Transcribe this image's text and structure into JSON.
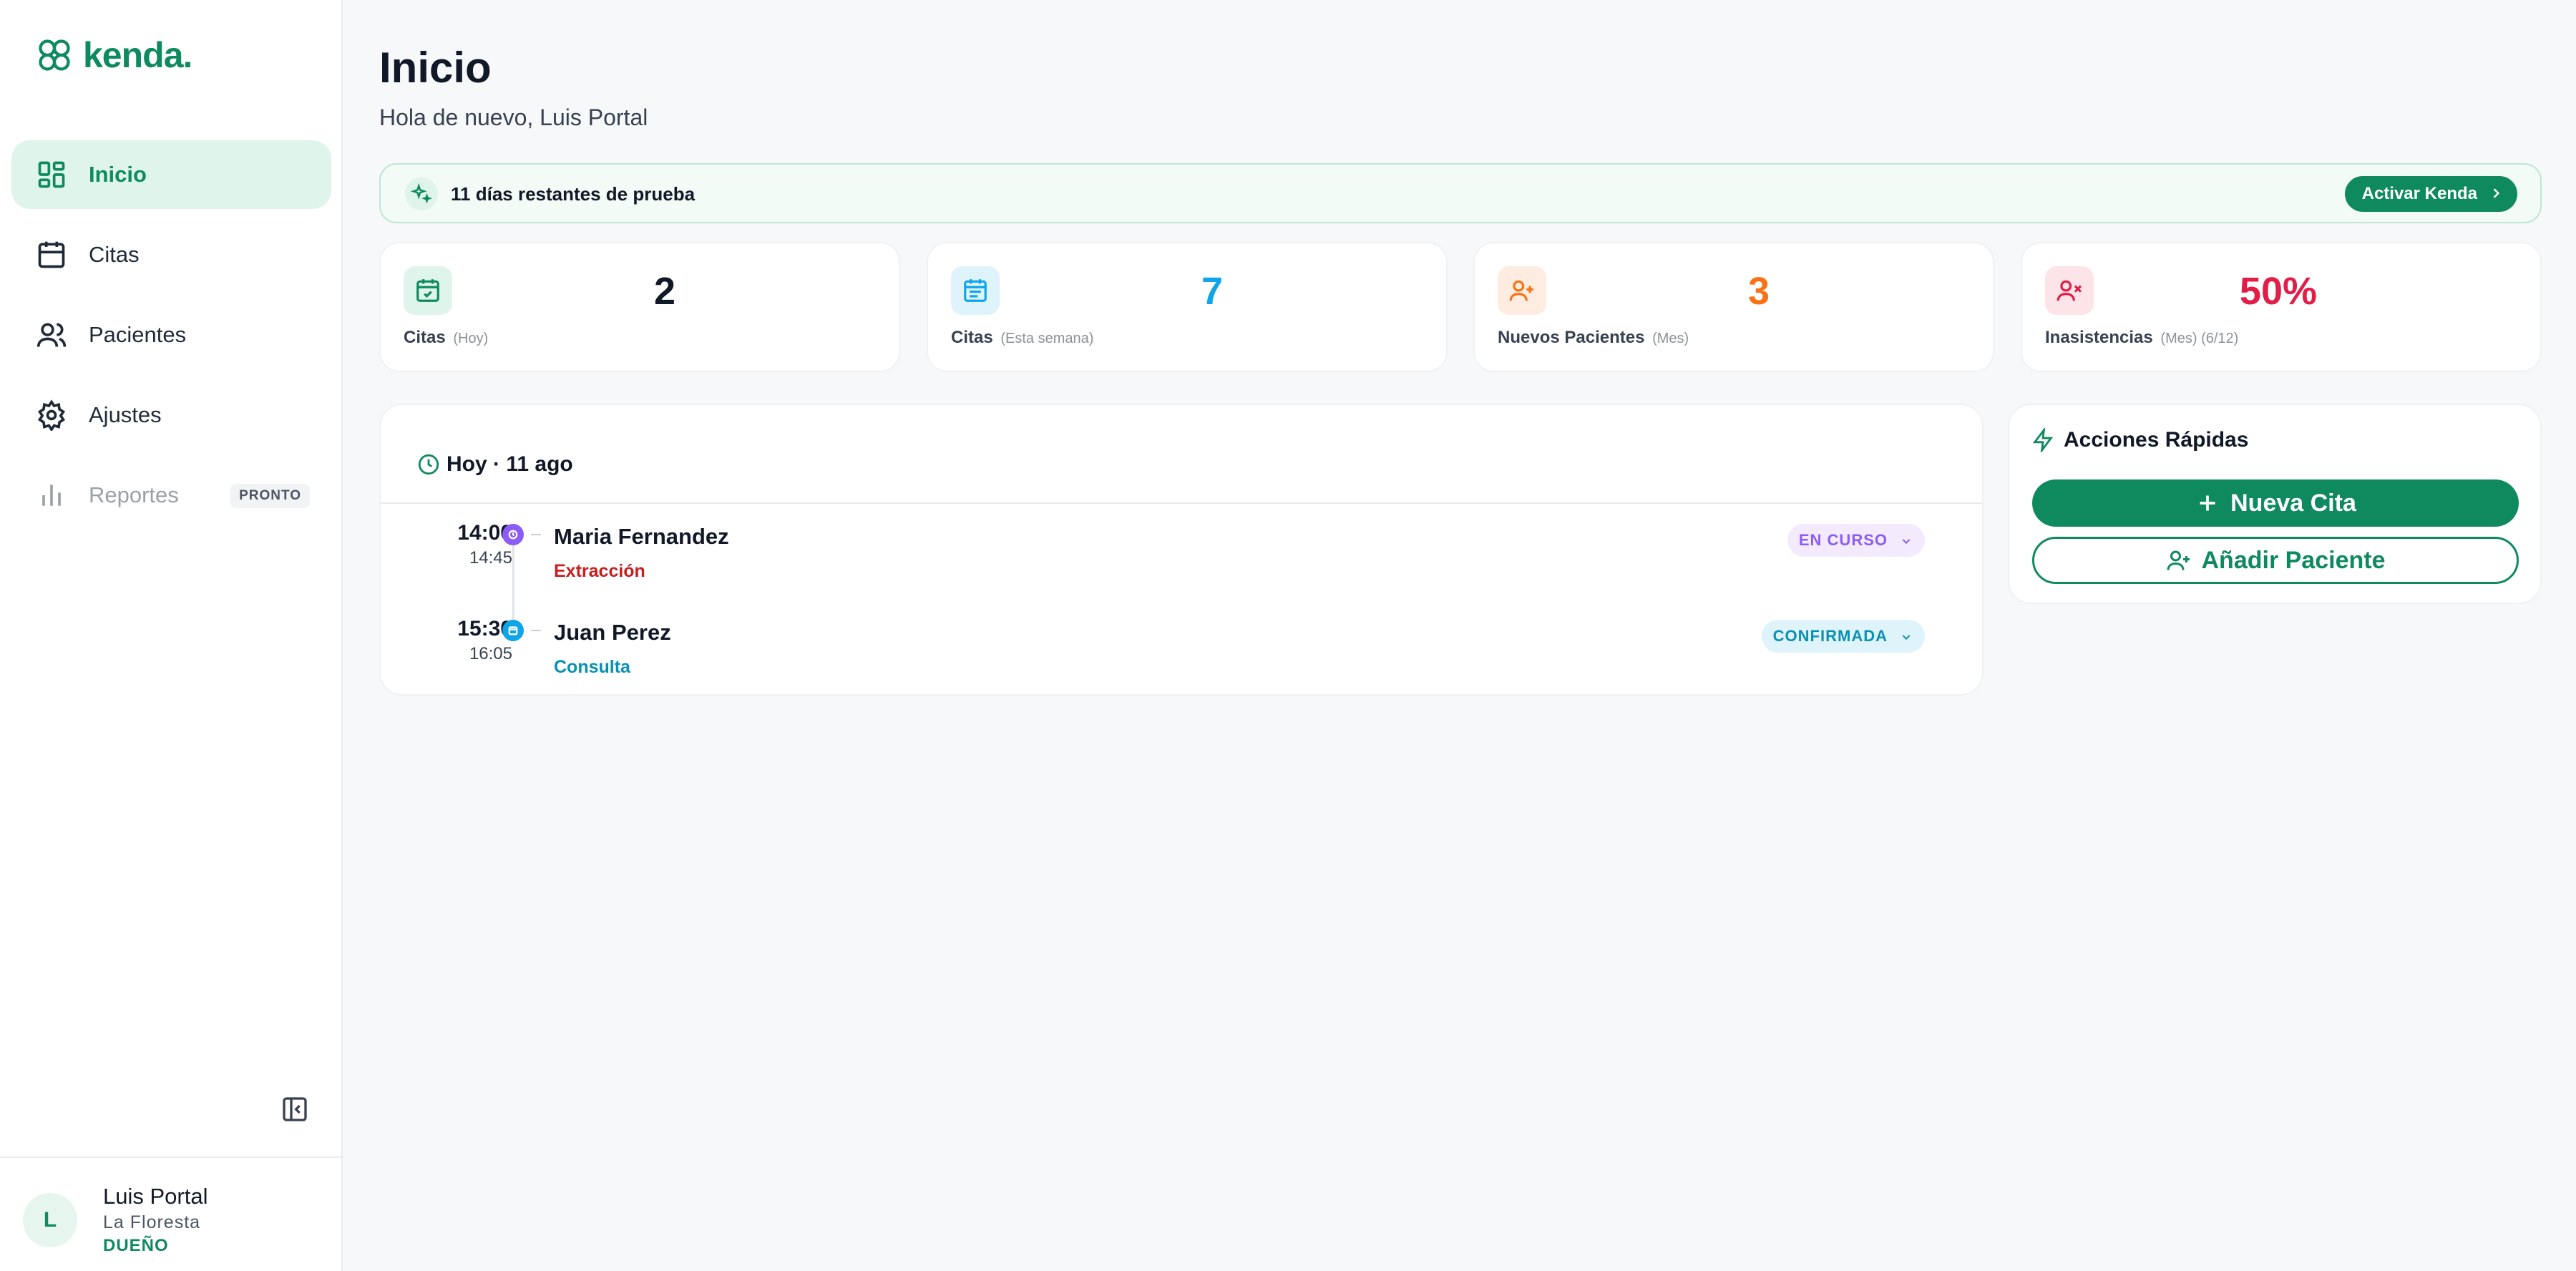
{
  "brand": {
    "name": "kenda."
  },
  "colors": {
    "accent": "#0f8a5f",
    "blue": "#0ea5e9",
    "orange": "#f97316",
    "red": "#e11d48",
    "purple": "#8b5cf6"
  },
  "sidebar": {
    "items": [
      {
        "label": "Inicio",
        "icon": "dashboard-icon",
        "active": true
      },
      {
        "label": "Citas",
        "icon": "calendar-icon"
      },
      {
        "label": "Pacientes",
        "icon": "users-icon"
      },
      {
        "label": "Ajustes",
        "icon": "gear-icon"
      },
      {
        "label": "Reportes",
        "icon": "bar-chart-icon",
        "badge": "PRONTO",
        "disabled": true
      }
    ],
    "user": {
      "initial": "L",
      "name": "Luis Portal",
      "org": "La Floresta",
      "role": "DUEÑO"
    }
  },
  "header": {
    "title": "Inicio",
    "subtitle": "Hola de nuevo, Luis Portal"
  },
  "trial": {
    "text": "11 días restantes de prueba",
    "button": "Activar Kenda"
  },
  "stats": [
    {
      "value": "2",
      "label": "Citas",
      "sub": "(Hoy)"
    },
    {
      "value": "7",
      "label": "Citas",
      "sub": "(Esta semana)"
    },
    {
      "value": "3",
      "label": "Nuevos Pacientes",
      "sub": "(Mes)"
    },
    {
      "value": "50%",
      "label": "Inasistencias",
      "sub": "(Mes) (6/12)"
    }
  ],
  "agenda": {
    "date": "Hoy · 11 ago",
    "appointments": [
      {
        "start": "14:00",
        "end": "14:45",
        "patient": "Maria Fernandez",
        "type": "Extracción",
        "status": "EN CURSO"
      },
      {
        "start": "15:30",
        "end": "16:05",
        "patient": "Juan Perez",
        "type": "Consulta",
        "status": "CONFIRMADA"
      }
    ]
  },
  "quick_actions": {
    "title": "Acciones Rápidas",
    "new_appointment": "Nueva Cita",
    "add_patient": "Añadir Paciente"
  }
}
